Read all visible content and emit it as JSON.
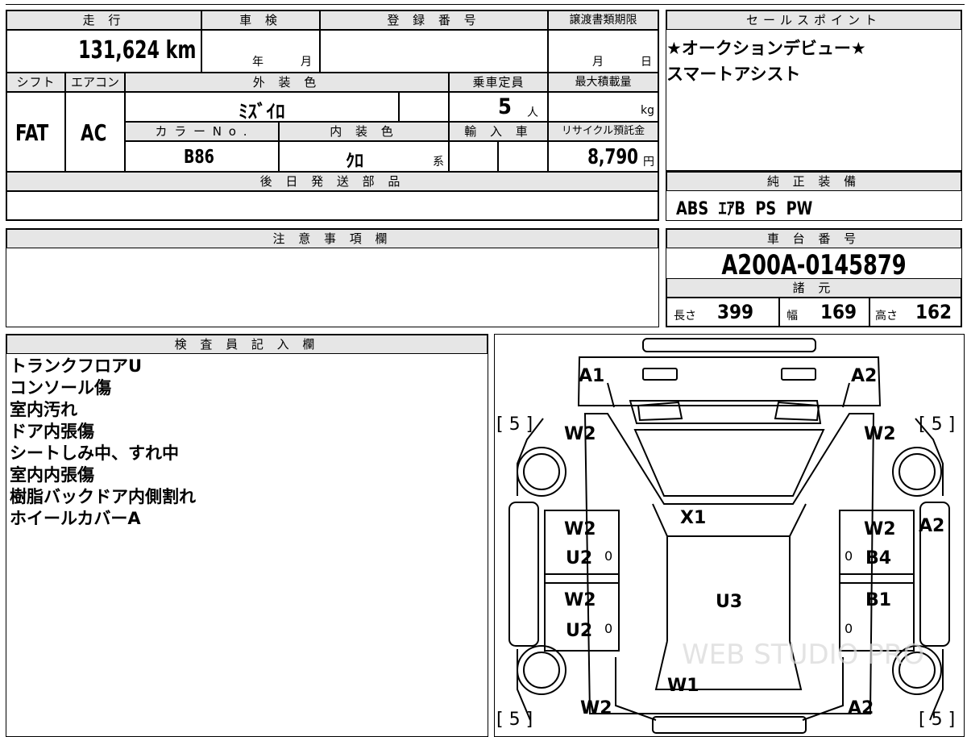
{
  "main": {
    "mileage_label": "走 行",
    "mileage_value": "131,624 km",
    "inspection_label": "車 検",
    "inspection_year_label": "年",
    "inspection_month_label": "月",
    "registration_label": "登 録 番 号",
    "registration_value": "",
    "transfer_deadline_label": "譲渡書類期限",
    "transfer_month_label": "月",
    "transfer_day_label": "日",
    "shift_label": "シフト",
    "shift_value": "FAT",
    "ac_label": "エアコン",
    "ac_value": "AC",
    "exterior_label": "外 装 色",
    "exterior_value": "ﾐｽﾞｲﾛ",
    "capacity_label": "乗車定員",
    "capacity_value": "5",
    "capacity_unit": "人",
    "max_load_label": "最大積載量",
    "max_load_unit": "kg",
    "color_no_label": "カ ラ ー N o .",
    "color_no_value": "B86",
    "interior_label": "内 装 色",
    "interior_value": "ｸﾛ",
    "interior_unit": "系",
    "import_label": "輸 入 車",
    "recycle_label": "リサイクル預託金",
    "recycle_value": "8,790",
    "recycle_unit": "円",
    "later_parts_label": "後 日 発 送 部 品",
    "later_parts_value": ""
  },
  "sales": {
    "label": "セールスポイント",
    "lines": [
      "★オークションデビュー★",
      "スマートアシスト"
    ]
  },
  "equipment": {
    "label": "純 正 装 備",
    "value": "ABS  ｴｱB  PS  PW"
  },
  "caution": {
    "label": "注 意 事 項 欄",
    "value": ""
  },
  "chassis": {
    "label": "車 台 番 号",
    "value": "A200A-0145879"
  },
  "specs": {
    "label": "諸 元",
    "length_label": "長さ",
    "length_value": "399",
    "width_label": "幅",
    "width_value": "169",
    "height_label": "高さ",
    "height_value": "162"
  },
  "inspector": {
    "label": "検 査 員 記 入 欄",
    "notes": [
      "トランクフロアU",
      "コンソール傷",
      "室内汚れ",
      "ドア内張傷",
      "シートしみ中、すれ中",
      "室内内張傷",
      "樹脂バックドア内側割れ",
      "ホイールカバーA"
    ]
  },
  "diagram": {
    "tires": [
      "[ 5 ]",
      "[ 5 ]",
      "[ 5 ]",
      "[ 5 ]"
    ],
    "marks": [
      "A1",
      "A2",
      "W2",
      "W2",
      "X1",
      "W2",
      "W2",
      "U2",
      "B4",
      "A2",
      "W2",
      "B1",
      "U2",
      "U3",
      "W1",
      "W2",
      "A2"
    ],
    "zeros": [
      "0",
      "0",
      "0",
      "0"
    ],
    "watermark": "WEB STUDIO PRO"
  }
}
